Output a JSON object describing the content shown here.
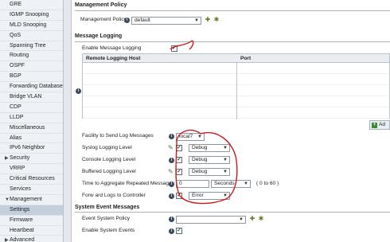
{
  "sidebar": {
    "items": [
      {
        "label": "GRE"
      },
      {
        "label": "IGMP Snooping"
      },
      {
        "label": "MLD Snooping"
      },
      {
        "label": "QoS"
      },
      {
        "label": "Spanning Tree"
      },
      {
        "label": "Routing"
      },
      {
        "label": "OSPF"
      },
      {
        "label": "BGP"
      },
      {
        "label": "Forwarding Database"
      },
      {
        "label": "Bridge VLAN"
      },
      {
        "label": "CDP"
      },
      {
        "label": "LLDP"
      },
      {
        "label": "Miscellaneous"
      },
      {
        "label": "Alias"
      },
      {
        "label": "IPv6 Neighbor"
      },
      {
        "label": "Security",
        "expandable": true
      },
      {
        "label": "VRRP"
      },
      {
        "label": "Critical Resources"
      },
      {
        "label": "Services"
      },
      {
        "label": "Management",
        "expandable": true,
        "expanded": true
      },
      {
        "label": "Settings",
        "selected": true
      },
      {
        "label": "Firmware"
      },
      {
        "label": "Heartbeat"
      },
      {
        "label": "Advanced",
        "expandable": true
      }
    ]
  },
  "management_policy": {
    "section_title": "Management Policy",
    "label": "Management Policy",
    "value": "default"
  },
  "message_logging": {
    "section_title": "Message Logging",
    "enable_label": "Enable Message Logging",
    "table": {
      "columns": [
        "Remote Logging Host",
        "Port"
      ],
      "rows": []
    },
    "add_button_label": "Ad",
    "facility_label": "Facility to Send Log Messages",
    "facility_value": "local7",
    "syslog_label": "Syslog Logging Level",
    "syslog_value": "Debug",
    "console_label": "Console Logging Level",
    "console_value": "Debug",
    "buffered_label": "Buffered Logging Level",
    "buffered_value": "Debug",
    "aggregate_label": "Time to Aggregate Repeated Messages",
    "aggregate_value": "0",
    "aggregate_unit": "Seconds",
    "aggregate_range": "( 0 to 60 )",
    "forward_label": "Forw ard Logs to Controller",
    "forward_value": "Error"
  },
  "system_events": {
    "section_title": "System Event Messages",
    "policy_label": "Event System Policy",
    "policy_value": "",
    "enable_label": "Enable System Events"
  },
  "colors": {
    "annotation": "#d01818",
    "selected_nav": "#c3d0dc"
  }
}
